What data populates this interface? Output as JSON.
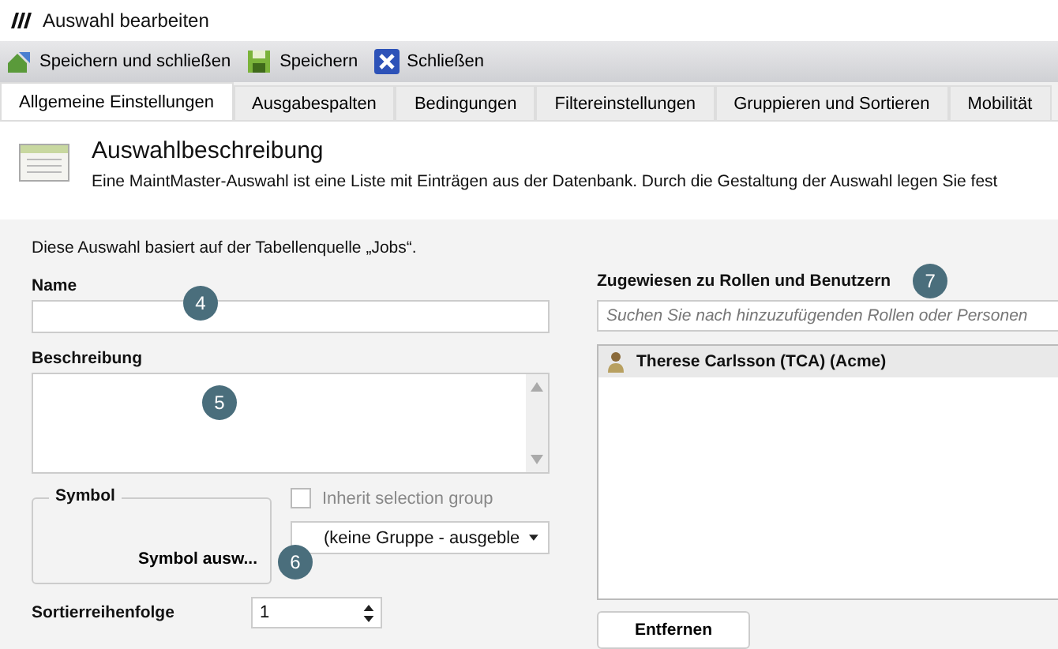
{
  "window": {
    "title": "Auswahl bearbeiten"
  },
  "toolbar": [
    {
      "kind": "save-close",
      "label": "Speichern und schließen"
    },
    {
      "kind": "save",
      "label": "Speichern"
    },
    {
      "kind": "close",
      "label": "Schließen"
    }
  ],
  "tabs": [
    {
      "label": "Allgemeine Einstellungen",
      "selected": true
    },
    {
      "label": "Ausgabespalten",
      "selected": false
    },
    {
      "label": "Bedingungen",
      "selected": false
    },
    {
      "label": "Filtereinstellungen",
      "selected": false
    },
    {
      "label": "Gruppieren und Sortieren",
      "selected": false
    },
    {
      "label": "Mobilität",
      "selected": false
    }
  ],
  "header": {
    "title": "Auswahlbeschreibung",
    "text": "Eine MaintMaster-Auswahl ist eine Liste mit Einträgen aus der Datenbank. Durch die Gestaltung der Auswahl legen Sie fest"
  },
  "source_note": "Diese Auswahl basiert auf der Tabellenquelle „Jobs“.",
  "name_field": {
    "label": "Name",
    "badge": "4"
  },
  "description_field": {
    "label": "Beschreibung",
    "badge": "5"
  },
  "symbol": {
    "legend": "Symbol",
    "button": "Symbol ausw...",
    "badge": "6"
  },
  "inherit_group": {
    "label": "Inherit selection group",
    "checked": false
  },
  "group_select": {
    "value": "(keine Gruppe - ausgeble"
  },
  "sort_order": {
    "label": "Sortierreihenfolge",
    "value": "1"
  },
  "assigned": {
    "label": "Zugewiesen zu Rollen und Benutzern",
    "badge": "7",
    "placeholder": "Suchen Sie nach hinzuzufügenden Rollen oder Personen",
    "items": [
      {
        "label": "Therese Carlsson (TCA) (Acme)",
        "selected": true
      }
    ],
    "remove_button": "Entfernen"
  }
}
